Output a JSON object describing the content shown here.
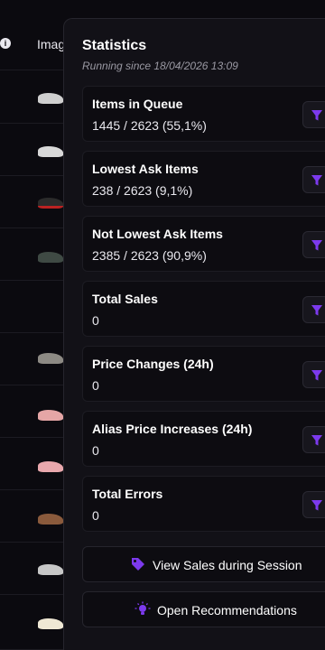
{
  "table": {
    "image_header": "Imag"
  },
  "statistics": {
    "title": "Statistics",
    "running_since": "Running since 18/04/2026 13:09",
    "cards": [
      {
        "label": "Items in Queue",
        "value": "1445 / 2623 (55,1%)"
      },
      {
        "label": "Lowest Ask Items",
        "value": "238 / 2623 (9,1%)"
      },
      {
        "label": "Not Lowest Ask Items",
        "value": "2385 / 2623 (90,9%)"
      },
      {
        "label": "Total Sales",
        "value": "0"
      },
      {
        "label": "Price Changes (24h)",
        "value": "0"
      },
      {
        "label": "Alias Price Increases (24h)",
        "value": "0"
      },
      {
        "label": "Total Errors",
        "value": "0"
      }
    ],
    "view_sales_label": "View Sales during Session",
    "open_recommendations_label": "Open Recommendations"
  },
  "colors": {
    "accent": "#7c3aed",
    "panel_bg": "#121117",
    "card_bg": "#0d0c11"
  }
}
